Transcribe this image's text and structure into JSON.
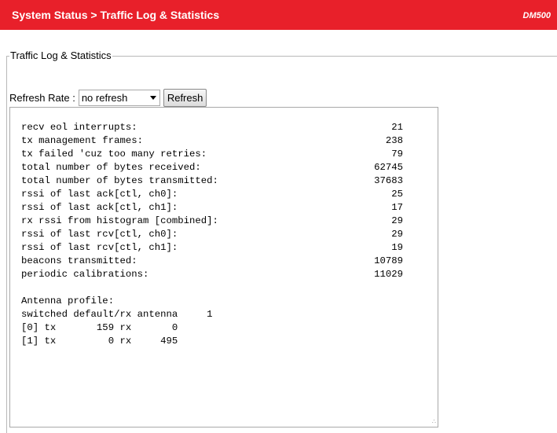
{
  "header": {
    "title": "System Status > Traffic Log & Statistics",
    "model": "DM500"
  },
  "section": {
    "legend": "Traffic Log & Statistics"
  },
  "refresh": {
    "label": "Refresh Rate :",
    "selected_option": "no refresh",
    "button_label": "Refresh"
  },
  "log": {
    "stats": [
      {
        "label": "recv eol interrupts:",
        "value": "21"
      },
      {
        "label": "tx management frames:",
        "value": "238"
      },
      {
        "label": "tx failed 'cuz too many retries:",
        "value": "79"
      },
      {
        "label": "total number of bytes received:",
        "value": "62745"
      },
      {
        "label": "total number of bytes transmitted:",
        "value": "37683"
      },
      {
        "label": "rssi of last ack[ctl, ch0]:",
        "value": "25"
      },
      {
        "label": "rssi of last ack[ctl, ch1]:",
        "value": "17"
      },
      {
        "label": "rx rssi from histogram [combined]:",
        "value": "29"
      },
      {
        "label": "rssi of last rcv[ctl, ch0]:",
        "value": "29"
      },
      {
        "label": "rssi of last rcv[ctl, ch1]:",
        "value": "19"
      },
      {
        "label": "beacons transmitted:",
        "value": "10789"
      },
      {
        "label": "periodic calibrations:",
        "value": "11029"
      }
    ],
    "antenna": {
      "heading": "Antenna profile:",
      "lines": [
        "switched default/rx antenna     1",
        "[0] tx       159 rx       0",
        "[1] tx         0 rx     495"
      ]
    },
    "resize_glyph": "∴"
  }
}
